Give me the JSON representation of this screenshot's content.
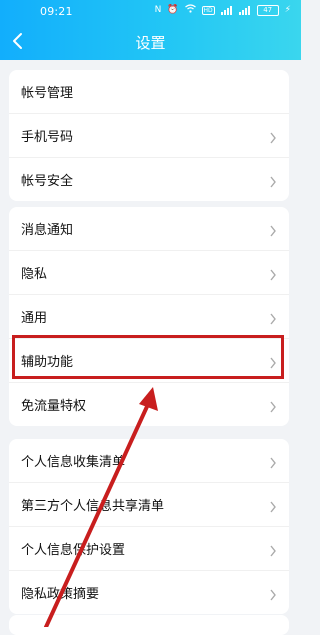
{
  "status_bar": {
    "time": "09:21",
    "icons": [
      "nfc-icon",
      "alarm-icon",
      "wifi-icon",
      "hd-icon",
      "signal-icon",
      "signal-icon",
      "battery-icon",
      "charging-icon"
    ],
    "battery_level": "47"
  },
  "header": {
    "title": "设置",
    "back_icon": "chevron-left-icon",
    "gradient_start": "#12aefc",
    "gradient_end": "#3ad6ee"
  },
  "groups": [
    {
      "items": [
        {
          "label": "帐号管理",
          "chevron": false
        },
        {
          "label": "手机号码",
          "chevron": true
        },
        {
          "label": "帐号安全",
          "chevron": true
        }
      ]
    },
    {
      "items": [
        {
          "label": "消息通知",
          "chevron": true
        },
        {
          "label": "隐私",
          "chevron": true
        },
        {
          "label": "通用",
          "chevron": true
        },
        {
          "label": "辅助功能",
          "chevron": true
        },
        {
          "label": "免流量特权",
          "chevron": true
        }
      ]
    },
    {
      "items": [
        {
          "label": "个人信息收集清单",
          "chevron": true
        },
        {
          "label": "第三方个人信息共享清单",
          "chevron": true
        },
        {
          "label": "个人信息保护设置",
          "chevron": true
        },
        {
          "label": "隐私政策摘要",
          "chevron": true
        }
      ]
    }
  ],
  "annotation": {
    "highlight_color": "#c81e1e",
    "highlighted_item": "辅助功能"
  }
}
